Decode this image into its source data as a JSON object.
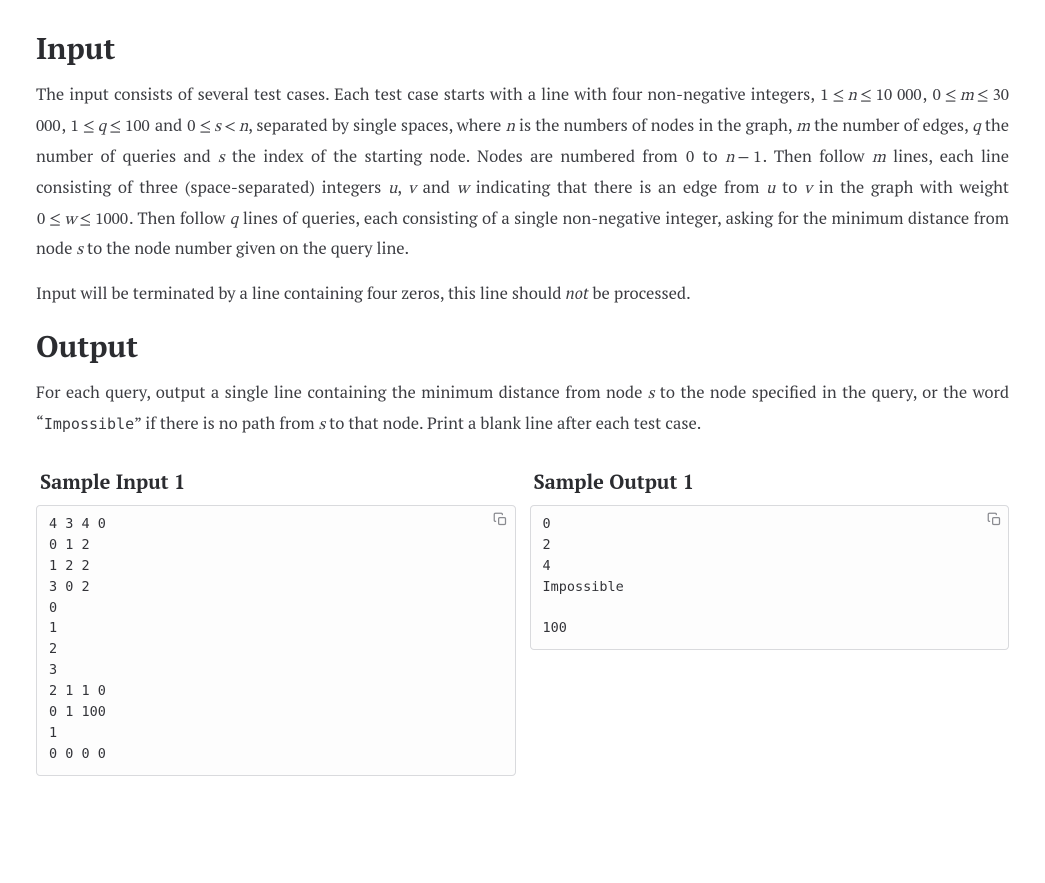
{
  "sections": {
    "input_heading": "Input",
    "output_heading": "Output"
  },
  "input_para1": {
    "pre": "The input consists of several test cases. Each test case starts with a line with four non-negative integers, ",
    "c1": "1 ≤ n ≤ 10 000",
    "sep1": ", ",
    "c2": "0 ≤ m ≤ 30 000",
    "sep2": ", ",
    "c3": "1 ≤ q ≤ 100",
    "sep3": " and ",
    "c4": "0 ≤ s < n",
    "post1": ", separated by single spaces, where ",
    "v_n": "n",
    "post2": " is the numbers of nodes in the graph, ",
    "v_m": "m",
    "post3": " the number of edges, ",
    "v_q": "q",
    "post4": " the number of queries and ",
    "v_s": "s",
    "post5": " the index of the starting node. Nodes are numbered from ",
    "zero": "0",
    "toTxt": " to ",
    "nminus1": "n − 1",
    "post6": ". Then follow ",
    "v_m2": "m",
    "post7": " lines, each line consisting of three (space-separated) integers ",
    "v_u": "u",
    "sepc": ", ",
    "v_v": "v",
    "andTxt": " and ",
    "v_w": "w",
    "post8": " indicating that there is an edge from ",
    "v_u2": "u",
    "toTxt2": " to ",
    "v_v2": "v",
    "post9": " in the graph with weight ",
    "wconstraint": "0 ≤ w ≤ 1000",
    "post10": ". Then follow ",
    "v_q2": "q",
    "post11": " lines of queries, each consisting of a single non-negative integer, asking for the minimum distance from node ",
    "v_s2": "s",
    "post12": " to the node number given on the query line."
  },
  "input_para2": {
    "pre": "Input will be terminated by a line containing four zeros, this line should ",
    "not": "not",
    "post": " be processed."
  },
  "output_para": {
    "pre": "For each query, output a single line containing the minimum distance from node ",
    "v_s": "s",
    "mid": " to the node specified in the query, or the word “",
    "imp": "Impossible",
    "post": "” if there is no path from ",
    "v_s2": "s",
    "post2": " to that node. Print a blank line after each test case."
  },
  "samples": {
    "input_heading": "Sample Input 1",
    "output_heading": "Sample Output 1",
    "input_text": "4 3 4 0\n0 1 2\n1 2 2\n3 0 2\n0\n1\n2\n3\n2 1 1 0\n0 1 100\n1\n0 0 0 0",
    "output_text": "0\n2\n4\nImpossible\n\n100"
  },
  "icons": {
    "copy": "copy"
  }
}
